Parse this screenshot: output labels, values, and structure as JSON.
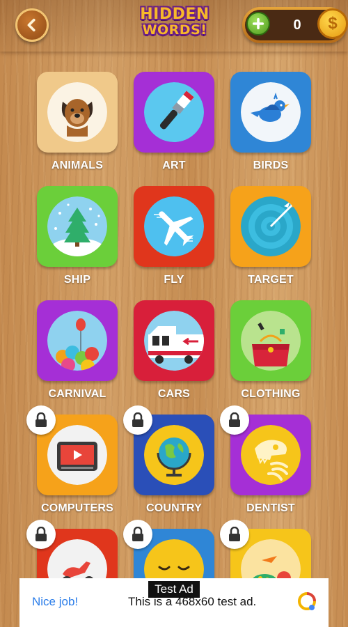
{
  "header": {
    "logo_line1": "HIDDEN",
    "logo_line2": "WORDS!",
    "coin_count": "0",
    "coin_symbol": "$"
  },
  "categories": [
    {
      "label": "ANIMALS",
      "color": "#f0c98a",
      "icon": "dog-icon",
      "locked": false
    },
    {
      "label": "ART",
      "color": "#a52fd6",
      "icon": "paintbrush-icon",
      "locked": false
    },
    {
      "label": "BIRDS",
      "color": "#2f86d6",
      "icon": "bird-icon",
      "locked": false
    },
    {
      "label": "SHIP",
      "color": "#6bcf3a",
      "icon": "snow-globe-tree-icon",
      "locked": false
    },
    {
      "label": "FLY",
      "color": "#e0361c",
      "icon": "airplane-icon",
      "locked": false
    },
    {
      "label": "TARGET",
      "color": "#f6a21a",
      "icon": "target-icon",
      "locked": false
    },
    {
      "label": "CARNIVAL",
      "color": "#a52fd6",
      "icon": "balloons-icon",
      "locked": false
    },
    {
      "label": "CARS",
      "color": "#d81f3a",
      "icon": "truck-icon",
      "locked": false
    },
    {
      "label": "CLOTHING",
      "color": "#6bcf3a",
      "icon": "handbag-icon",
      "locked": false
    },
    {
      "label": "COMPUTERS",
      "color": "#f6a21a",
      "icon": "tv-icon",
      "locked": true
    },
    {
      "label": "COUNTRY",
      "color": "#2a4fb8",
      "icon": "globe-icon",
      "locked": true
    },
    {
      "label": "DENTIST",
      "color": "#a52fd6",
      "icon": "dinosaur-skull-icon",
      "locked": true
    },
    {
      "label": "",
      "color": "#e0361c",
      "icon": "scooter-icon",
      "locked": true
    },
    {
      "label": "",
      "color": "#2f86d6",
      "icon": "sad-face-icon",
      "locked": true
    },
    {
      "label": "",
      "color": "#f6c51a",
      "icon": "food-icon",
      "locked": true
    }
  ],
  "ad": {
    "tag": "Test Ad",
    "left_text": "Nice job!",
    "body_text": "This is a 468x60 test ad."
  }
}
